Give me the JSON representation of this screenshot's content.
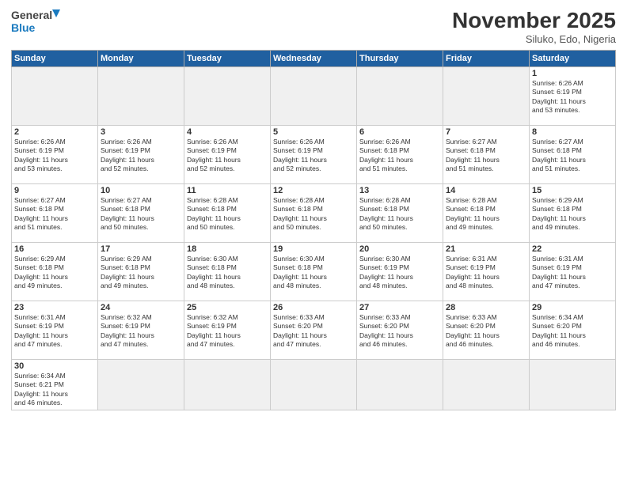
{
  "header": {
    "logo_general": "General",
    "logo_blue": "Blue",
    "month_title": "November 2025",
    "subtitle": "Siluko, Edo, Nigeria"
  },
  "weekdays": [
    "Sunday",
    "Monday",
    "Tuesday",
    "Wednesday",
    "Thursday",
    "Friday",
    "Saturday"
  ],
  "weeks": [
    [
      {
        "day": "",
        "info": "",
        "empty": true
      },
      {
        "day": "",
        "info": "",
        "empty": true
      },
      {
        "day": "",
        "info": "",
        "empty": true
      },
      {
        "day": "",
        "info": "",
        "empty": true
      },
      {
        "day": "",
        "info": "",
        "empty": true
      },
      {
        "day": "",
        "info": "",
        "empty": true
      },
      {
        "day": "1",
        "info": "Sunrise: 6:26 AM\nSunset: 6:19 PM\nDaylight: 11 hours\nand 53 minutes."
      }
    ],
    [
      {
        "day": "2",
        "info": "Sunrise: 6:26 AM\nSunset: 6:19 PM\nDaylight: 11 hours\nand 53 minutes."
      },
      {
        "day": "3",
        "info": "Sunrise: 6:26 AM\nSunset: 6:19 PM\nDaylight: 11 hours\nand 52 minutes."
      },
      {
        "day": "4",
        "info": "Sunrise: 6:26 AM\nSunset: 6:19 PM\nDaylight: 11 hours\nand 52 minutes."
      },
      {
        "day": "5",
        "info": "Sunrise: 6:26 AM\nSunset: 6:19 PM\nDaylight: 11 hours\nand 52 minutes."
      },
      {
        "day": "6",
        "info": "Sunrise: 6:26 AM\nSunset: 6:18 PM\nDaylight: 11 hours\nand 51 minutes."
      },
      {
        "day": "7",
        "info": "Sunrise: 6:27 AM\nSunset: 6:18 PM\nDaylight: 11 hours\nand 51 minutes."
      },
      {
        "day": "8",
        "info": "Sunrise: 6:27 AM\nSunset: 6:18 PM\nDaylight: 11 hours\nand 51 minutes."
      }
    ],
    [
      {
        "day": "9",
        "info": "Sunrise: 6:27 AM\nSunset: 6:18 PM\nDaylight: 11 hours\nand 51 minutes."
      },
      {
        "day": "10",
        "info": "Sunrise: 6:27 AM\nSunset: 6:18 PM\nDaylight: 11 hours\nand 50 minutes."
      },
      {
        "day": "11",
        "info": "Sunrise: 6:28 AM\nSunset: 6:18 PM\nDaylight: 11 hours\nand 50 minutes."
      },
      {
        "day": "12",
        "info": "Sunrise: 6:28 AM\nSunset: 6:18 PM\nDaylight: 11 hours\nand 50 minutes."
      },
      {
        "day": "13",
        "info": "Sunrise: 6:28 AM\nSunset: 6:18 PM\nDaylight: 11 hours\nand 50 minutes."
      },
      {
        "day": "14",
        "info": "Sunrise: 6:28 AM\nSunset: 6:18 PM\nDaylight: 11 hours\nand 49 minutes."
      },
      {
        "day": "15",
        "info": "Sunrise: 6:29 AM\nSunset: 6:18 PM\nDaylight: 11 hours\nand 49 minutes."
      }
    ],
    [
      {
        "day": "16",
        "info": "Sunrise: 6:29 AM\nSunset: 6:18 PM\nDaylight: 11 hours\nand 49 minutes."
      },
      {
        "day": "17",
        "info": "Sunrise: 6:29 AM\nSunset: 6:18 PM\nDaylight: 11 hours\nand 49 minutes."
      },
      {
        "day": "18",
        "info": "Sunrise: 6:30 AM\nSunset: 6:18 PM\nDaylight: 11 hours\nand 48 minutes."
      },
      {
        "day": "19",
        "info": "Sunrise: 6:30 AM\nSunset: 6:18 PM\nDaylight: 11 hours\nand 48 minutes."
      },
      {
        "day": "20",
        "info": "Sunrise: 6:30 AM\nSunset: 6:19 PM\nDaylight: 11 hours\nand 48 minutes."
      },
      {
        "day": "21",
        "info": "Sunrise: 6:31 AM\nSunset: 6:19 PM\nDaylight: 11 hours\nand 48 minutes."
      },
      {
        "day": "22",
        "info": "Sunrise: 6:31 AM\nSunset: 6:19 PM\nDaylight: 11 hours\nand 47 minutes."
      }
    ],
    [
      {
        "day": "23",
        "info": "Sunrise: 6:31 AM\nSunset: 6:19 PM\nDaylight: 11 hours\nand 47 minutes."
      },
      {
        "day": "24",
        "info": "Sunrise: 6:32 AM\nSunset: 6:19 PM\nDaylight: 11 hours\nand 47 minutes."
      },
      {
        "day": "25",
        "info": "Sunrise: 6:32 AM\nSunset: 6:19 PM\nDaylight: 11 hours\nand 47 minutes."
      },
      {
        "day": "26",
        "info": "Sunrise: 6:33 AM\nSunset: 6:20 PM\nDaylight: 11 hours\nand 47 minutes."
      },
      {
        "day": "27",
        "info": "Sunrise: 6:33 AM\nSunset: 6:20 PM\nDaylight: 11 hours\nand 46 minutes."
      },
      {
        "day": "28",
        "info": "Sunrise: 6:33 AM\nSunset: 6:20 PM\nDaylight: 11 hours\nand 46 minutes."
      },
      {
        "day": "29",
        "info": "Sunrise: 6:34 AM\nSunset: 6:20 PM\nDaylight: 11 hours\nand 46 minutes."
      }
    ],
    [
      {
        "day": "30",
        "info": "Sunrise: 6:34 AM\nSunset: 6:21 PM\nDaylight: 11 hours\nand 46 minutes.",
        "last": true
      },
      {
        "day": "",
        "info": "",
        "empty": true,
        "last": true
      },
      {
        "day": "",
        "info": "",
        "empty": true,
        "last": true
      },
      {
        "day": "",
        "info": "",
        "empty": true,
        "last": true
      },
      {
        "day": "",
        "info": "",
        "empty": true,
        "last": true
      },
      {
        "day": "",
        "info": "",
        "empty": true,
        "last": true
      },
      {
        "day": "",
        "info": "",
        "empty": true,
        "last": true
      }
    ]
  ]
}
